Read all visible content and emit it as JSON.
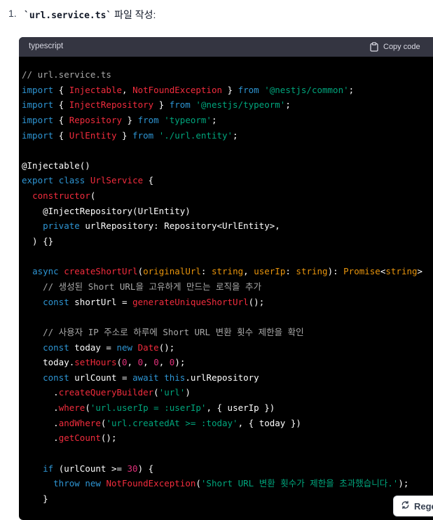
{
  "step": {
    "number": "1.",
    "code": "`url.service.ts`",
    "text": " 파일 작성:"
  },
  "code_block": {
    "language": "typescript",
    "copy_label": "Copy code",
    "lines": [
      [
        {
          "c": "c",
          "t": "// url.service.ts"
        }
      ],
      [
        {
          "c": "k",
          "t": "import"
        },
        {
          "c": "",
          "t": " { "
        },
        {
          "c": "t",
          "t": "Injectable"
        },
        {
          "c": "",
          "t": ", "
        },
        {
          "c": "t",
          "t": "NotFoundException"
        },
        {
          "c": "",
          "t": " } "
        },
        {
          "c": "k",
          "t": "from"
        },
        {
          "c": "",
          "t": " "
        },
        {
          "c": "s",
          "t": "'@nestjs/common'"
        },
        {
          "c": "",
          "t": ";"
        }
      ],
      [
        {
          "c": "k",
          "t": "import"
        },
        {
          "c": "",
          "t": " { "
        },
        {
          "c": "t",
          "t": "InjectRepository"
        },
        {
          "c": "",
          "t": " } "
        },
        {
          "c": "k",
          "t": "from"
        },
        {
          "c": "",
          "t": " "
        },
        {
          "c": "s",
          "t": "'@nestjs/typeorm'"
        },
        {
          "c": "",
          "t": ";"
        }
      ],
      [
        {
          "c": "k",
          "t": "import"
        },
        {
          "c": "",
          "t": " { "
        },
        {
          "c": "t",
          "t": "Repository"
        },
        {
          "c": "",
          "t": " } "
        },
        {
          "c": "k",
          "t": "from"
        },
        {
          "c": "",
          "t": " "
        },
        {
          "c": "s",
          "t": "'typeorm'"
        },
        {
          "c": "",
          "t": ";"
        }
      ],
      [
        {
          "c": "k",
          "t": "import"
        },
        {
          "c": "",
          "t": " { "
        },
        {
          "c": "t",
          "t": "UrlEntity"
        },
        {
          "c": "",
          "t": " } "
        },
        {
          "c": "k",
          "t": "from"
        },
        {
          "c": "",
          "t": " "
        },
        {
          "c": "s",
          "t": "'./url.entity'"
        },
        {
          "c": "",
          "t": ";"
        }
      ],
      [],
      [
        {
          "c": "",
          "t": "@Injectable()"
        }
      ],
      [
        {
          "c": "k",
          "t": "export"
        },
        {
          "c": "",
          "t": " "
        },
        {
          "c": "k",
          "t": "class"
        },
        {
          "c": "",
          "t": " "
        },
        {
          "c": "t",
          "t": "UrlService"
        },
        {
          "c": "",
          "t": " {"
        }
      ],
      [
        {
          "c": "",
          "t": "  "
        },
        {
          "c": "t",
          "t": "constructor"
        },
        {
          "c": "",
          "t": "("
        }
      ],
      [
        {
          "c": "",
          "t": "    @InjectRepository(UrlEntity)"
        }
      ],
      [
        {
          "c": "",
          "t": "    "
        },
        {
          "c": "k",
          "t": "private"
        },
        {
          "c": "",
          "t": " urlRepository: Repository<UrlEntity>,"
        }
      ],
      [
        {
          "c": "",
          "t": "  ) {}"
        }
      ],
      [],
      [
        {
          "c": "",
          "t": "  "
        },
        {
          "c": "k",
          "t": "async"
        },
        {
          "c": "",
          "t": " "
        },
        {
          "c": "t",
          "t": "createShortUrl"
        },
        {
          "c": "",
          "t": "("
        },
        {
          "c": "ty",
          "t": "originalUrl"
        },
        {
          "c": "",
          "t": ": "
        },
        {
          "c": "ty",
          "t": "string"
        },
        {
          "c": "",
          "t": ", "
        },
        {
          "c": "ty",
          "t": "userIp"
        },
        {
          "c": "",
          "t": ": "
        },
        {
          "c": "ty",
          "t": "string"
        },
        {
          "c": "",
          "t": "): "
        },
        {
          "c": "ty",
          "t": "Promise"
        },
        {
          "c": "",
          "t": "<"
        },
        {
          "c": "ty",
          "t": "string"
        },
        {
          "c": "",
          "t": ">"
        }
      ],
      [
        {
          "c": "",
          "t": "    "
        },
        {
          "c": "c",
          "t": "// 생성된 Short URL을 고유하게 만드는 로직을 추가"
        }
      ],
      [
        {
          "c": "",
          "t": "    "
        },
        {
          "c": "k",
          "t": "const"
        },
        {
          "c": "",
          "t": " shortUrl = "
        },
        {
          "c": "t",
          "t": "generateUniqueShortUrl"
        },
        {
          "c": "",
          "t": "();"
        }
      ],
      [],
      [
        {
          "c": "",
          "t": "    "
        },
        {
          "c": "c",
          "t": "// 사용자 IP 주소로 하루에 Short URL 변환 횟수 제한을 확인"
        }
      ],
      [
        {
          "c": "",
          "t": "    "
        },
        {
          "c": "k",
          "t": "const"
        },
        {
          "c": "",
          "t": " today = "
        },
        {
          "c": "k",
          "t": "new"
        },
        {
          "c": "",
          "t": " "
        },
        {
          "c": "t",
          "t": "Date"
        },
        {
          "c": "",
          "t": "();"
        }
      ],
      [
        {
          "c": "",
          "t": "    today."
        },
        {
          "c": "t",
          "t": "setHours"
        },
        {
          "c": "",
          "t": "("
        },
        {
          "c": "n",
          "t": "0"
        },
        {
          "c": "",
          "t": ", "
        },
        {
          "c": "n",
          "t": "0"
        },
        {
          "c": "",
          "t": ", "
        },
        {
          "c": "n",
          "t": "0"
        },
        {
          "c": "",
          "t": ", "
        },
        {
          "c": "n",
          "t": "0"
        },
        {
          "c": "",
          "t": ");"
        }
      ],
      [
        {
          "c": "",
          "t": "    "
        },
        {
          "c": "k",
          "t": "const"
        },
        {
          "c": "",
          "t": " urlCount = "
        },
        {
          "c": "k",
          "t": "await"
        },
        {
          "c": "",
          "t": " "
        },
        {
          "c": "k",
          "t": "this"
        },
        {
          "c": "",
          "t": ".urlRepository"
        }
      ],
      [
        {
          "c": "",
          "t": "      ."
        },
        {
          "c": "t",
          "t": "createQueryBuilder"
        },
        {
          "c": "",
          "t": "("
        },
        {
          "c": "s",
          "t": "'url'"
        },
        {
          "c": "",
          "t": ")"
        }
      ],
      [
        {
          "c": "",
          "t": "      ."
        },
        {
          "c": "t",
          "t": "where"
        },
        {
          "c": "",
          "t": "("
        },
        {
          "c": "s",
          "t": "'url.userIp = :userIp'"
        },
        {
          "c": "",
          "t": ", { userIp })"
        }
      ],
      [
        {
          "c": "",
          "t": "      ."
        },
        {
          "c": "t",
          "t": "andWhere"
        },
        {
          "c": "",
          "t": "("
        },
        {
          "c": "s",
          "t": "'url.createdAt >= :today'"
        },
        {
          "c": "",
          "t": ", { today })"
        }
      ],
      [
        {
          "c": "",
          "t": "      ."
        },
        {
          "c": "t",
          "t": "getCount"
        },
        {
          "c": "",
          "t": "();"
        }
      ],
      [],
      [
        {
          "c": "",
          "t": "    "
        },
        {
          "c": "k",
          "t": "if"
        },
        {
          "c": "",
          "t": " (urlCount >= "
        },
        {
          "c": "n",
          "t": "30"
        },
        {
          "c": "",
          "t": ") {"
        }
      ],
      [
        {
          "c": "",
          "t": "      "
        },
        {
          "c": "k",
          "t": "throw"
        },
        {
          "c": "",
          "t": " "
        },
        {
          "c": "k",
          "t": "new"
        },
        {
          "c": "",
          "t": " "
        },
        {
          "c": "t",
          "t": "NotFoundException"
        },
        {
          "c": "",
          "t": "("
        },
        {
          "c": "s",
          "t": "'Short URL 변환 횟수가 제한을 초과했습니다.'"
        },
        {
          "c": "",
          "t": ");"
        }
      ],
      [
        {
          "c": "",
          "t": "    }"
        }
      ]
    ]
  },
  "regenerate_label": "Rege"
}
